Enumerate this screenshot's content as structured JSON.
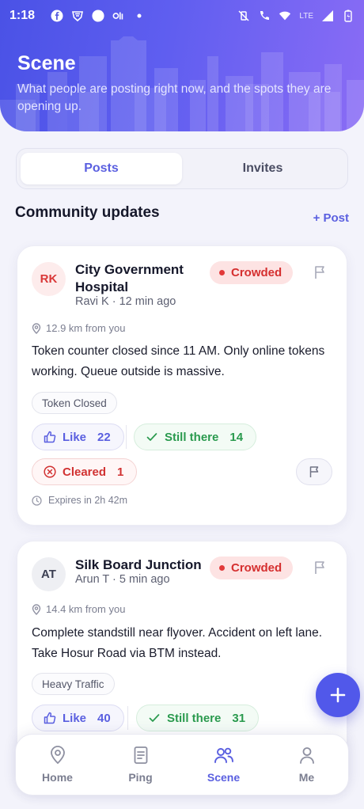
{
  "status_bar": {
    "time": "1:18",
    "network_label": "LTE"
  },
  "header": {
    "title": "Scene",
    "subtitle": "What people are posting right now, and the spots they are opening up."
  },
  "tabs": [
    {
      "label": "Posts",
      "active": true
    },
    {
      "label": "Invites",
      "active": false
    }
  ],
  "section": {
    "title": "Community updates",
    "add_label": "+ Post"
  },
  "posts": [
    {
      "initials": "RK",
      "place": "City Government Hospital",
      "meta": "Ravi K · 12 min ago",
      "status": "Crowded",
      "distance": "12.9 km from you",
      "text": "Token counter closed since 11 AM. Only online tokens working. Queue outside is massive.",
      "tag": "Token Closed",
      "like_label": "Like",
      "like_count": "22",
      "there_label": "Still there",
      "there_count": "14",
      "cleared_label": "Cleared",
      "cleared_count": "1",
      "expires": "Expires in 2h 42m"
    },
    {
      "initials": "AT",
      "place": "Silk Board Junction",
      "meta": "Arun T · 5 min ago",
      "status": "Crowded",
      "distance": "14.4 km from you",
      "text": "Complete standstill near flyover. Accident on left lane. Take Hosur Road via BTM instead.",
      "tag": "Heavy Traffic",
      "like_label": "Like",
      "like_count": "40",
      "there_label": "Still there",
      "there_count": "31"
    }
  ],
  "nav": [
    {
      "label": "Home",
      "icon": "location-pin-icon",
      "active": false
    },
    {
      "label": "Ping",
      "icon": "document-icon",
      "active": false
    },
    {
      "label": "Scene",
      "icon": "people-icon",
      "active": true
    },
    {
      "label": "Me",
      "icon": "person-icon",
      "active": false
    }
  ],
  "colors": {
    "accent": "#5A5FE0",
    "crowded": "#D52F2F",
    "still_there": "#2A9A4E"
  }
}
